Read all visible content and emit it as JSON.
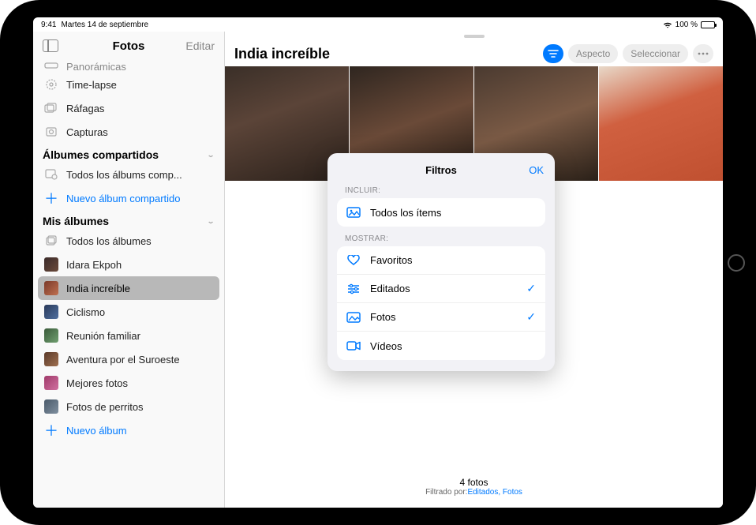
{
  "status": {
    "time": "9:41",
    "date": "Martes 14 de septiembre",
    "battery_pct": "100 %"
  },
  "sidebar": {
    "title": "Fotos",
    "edit": "Editar",
    "media_types": [
      {
        "label": "Panorámicas",
        "icon": "panorama"
      },
      {
        "label": "Time-lapse",
        "icon": "timelapse"
      },
      {
        "label": "Ráfagas",
        "icon": "burst"
      },
      {
        "label": "Capturas",
        "icon": "screenshot"
      }
    ],
    "shared_section": "Álbumes compartidos",
    "shared_items": [
      {
        "label": "Todos los álbums comp...",
        "icon": "shared-all"
      }
    ],
    "new_shared": "Nuevo álbum compartido",
    "my_section": "Mis álbumes",
    "my_items": [
      {
        "label": "Todos los álbumes",
        "icon": "albums-all",
        "thumb_cls": ""
      },
      {
        "label": "Idara Ekpoh",
        "thumb_cls": "th-a"
      },
      {
        "label": "India increíble",
        "thumb_cls": "th-b",
        "selected": true
      },
      {
        "label": "Ciclismo",
        "thumb_cls": "th-c"
      },
      {
        "label": "Reunión familiar",
        "thumb_cls": "th-d"
      },
      {
        "label": "Aventura por el Suroeste",
        "thumb_cls": "th-e"
      },
      {
        "label": "Mejores fotos",
        "thumb_cls": "th-f"
      },
      {
        "label": "Fotos de perritos",
        "thumb_cls": "th-g"
      }
    ],
    "new_album": "Nuevo álbum"
  },
  "main": {
    "album_title": "India increíble",
    "aspect_btn": "Aspecto",
    "select_btn": "Seleccionar",
    "footer_count": "4 fotos",
    "footer_prefix": "Filtrado por:",
    "footer_filters": "Editados, Fotos"
  },
  "popover": {
    "title": "Filtros",
    "ok": "OK",
    "include_label": "INCLUIR:",
    "include_rows": [
      {
        "label": "Todos los ítems",
        "icon": "all-items",
        "checked": false
      }
    ],
    "show_label": "MOSTRAR:",
    "show_rows": [
      {
        "label": "Favoritos",
        "icon": "heart",
        "checked": false
      },
      {
        "label": "Editados",
        "icon": "sliders",
        "checked": true
      },
      {
        "label": "Fotos",
        "icon": "photo",
        "checked": true
      },
      {
        "label": "Vídeos",
        "icon": "video",
        "checked": false
      }
    ]
  }
}
